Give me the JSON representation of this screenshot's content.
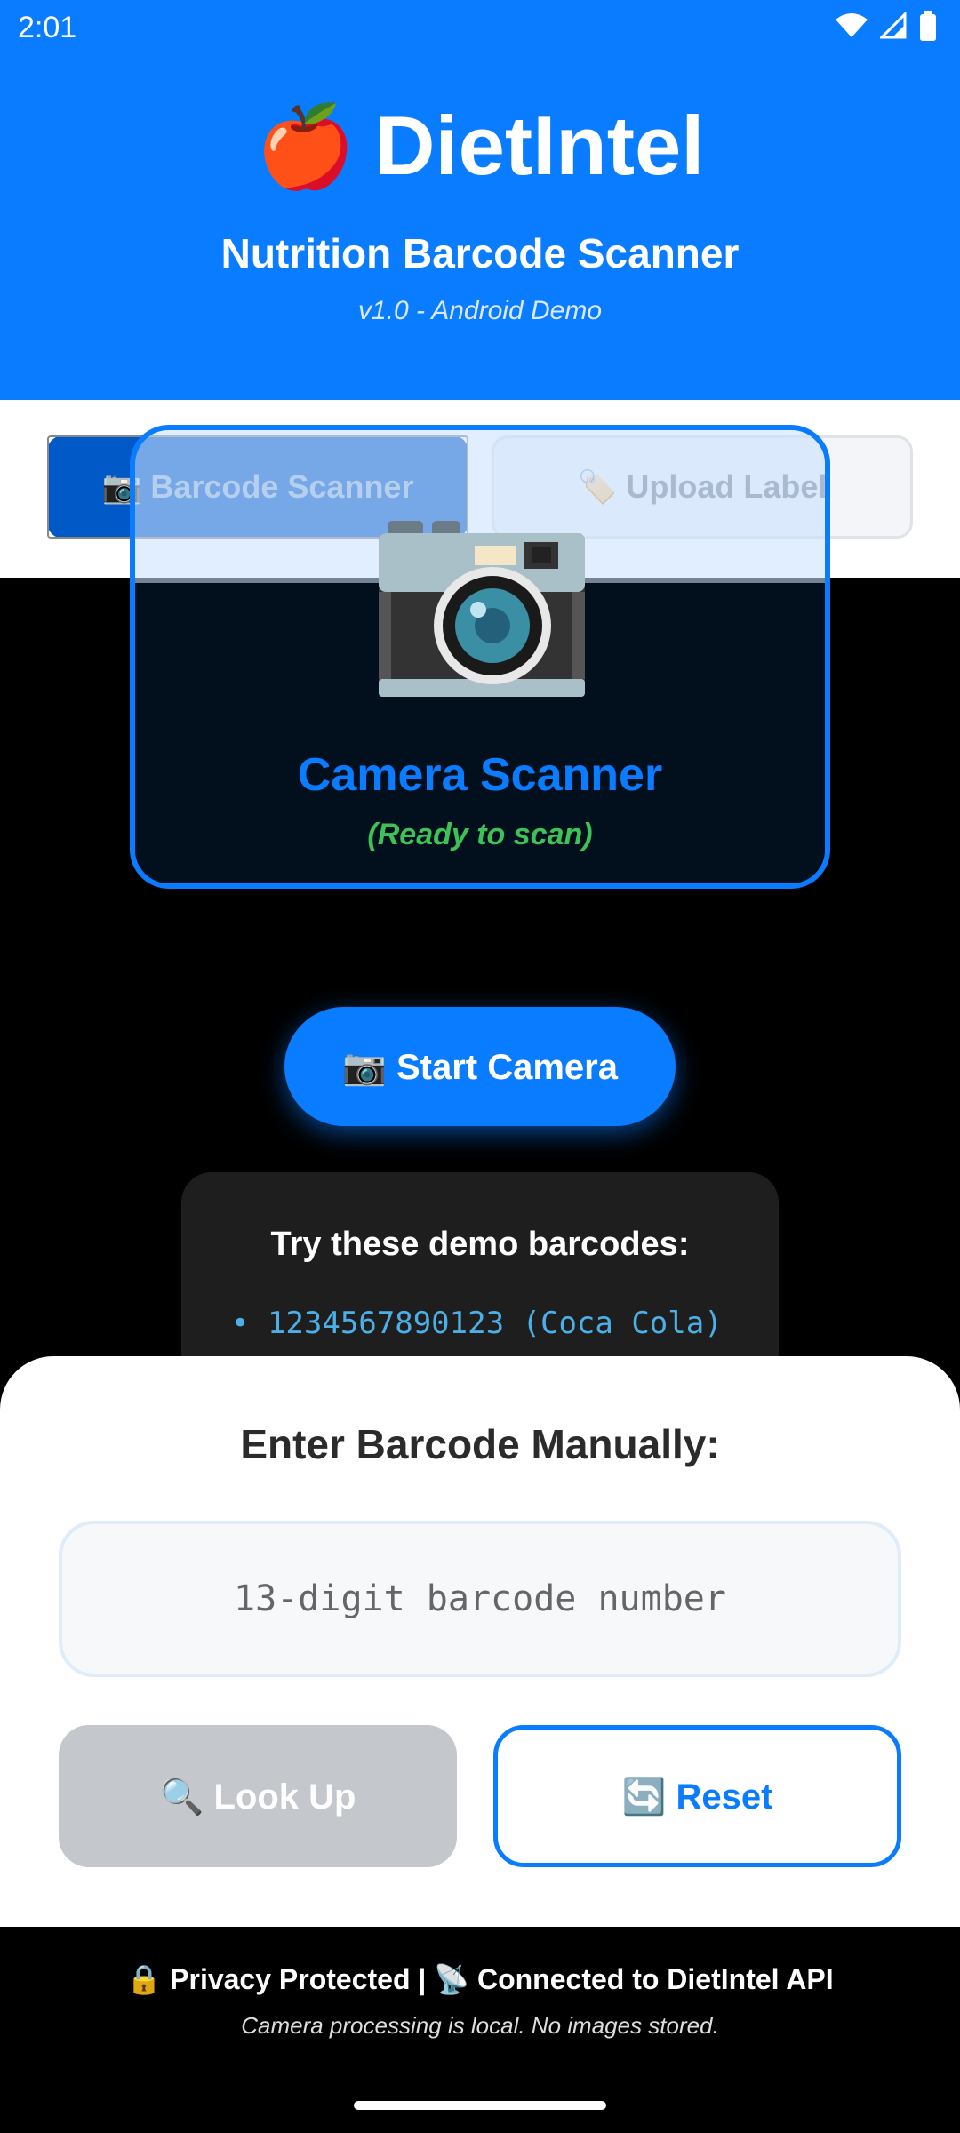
{
  "status_bar": {
    "time": "2:01"
  },
  "header": {
    "app_emoji": "🍎",
    "app_title": "DietIntel",
    "subtitle": "Nutrition Barcode Scanner",
    "version": "v1.0 - Android Demo"
  },
  "tabs": [
    {
      "label": "📷 Barcode Scanner",
      "active": true
    },
    {
      "label": "🏷️ Upload Label",
      "active": false
    }
  ],
  "scanner": {
    "icon": "camera-icon",
    "title": "Camera Scanner",
    "status": "(Ready to scan)"
  },
  "start_camera_label": "📷 Start Camera",
  "demo": {
    "title": "Try these demo barcodes:",
    "items": [
      "• 1234567890123 (Coca Cola)"
    ]
  },
  "manual": {
    "title": "Enter Barcode Manually:",
    "placeholder": "13-digit barcode number",
    "value": "",
    "lookup_label": "🔍 Look Up",
    "reset_label": "🔄 Reset"
  },
  "footer": {
    "main": "🔒 Privacy Protected | 📡 Connected to DietIntel API",
    "note": "Camera processing is local. No images stored."
  },
  "colors": {
    "primary": "#0a7cff",
    "status_ready": "#3cc257",
    "disabled": "#c4c7cb"
  }
}
